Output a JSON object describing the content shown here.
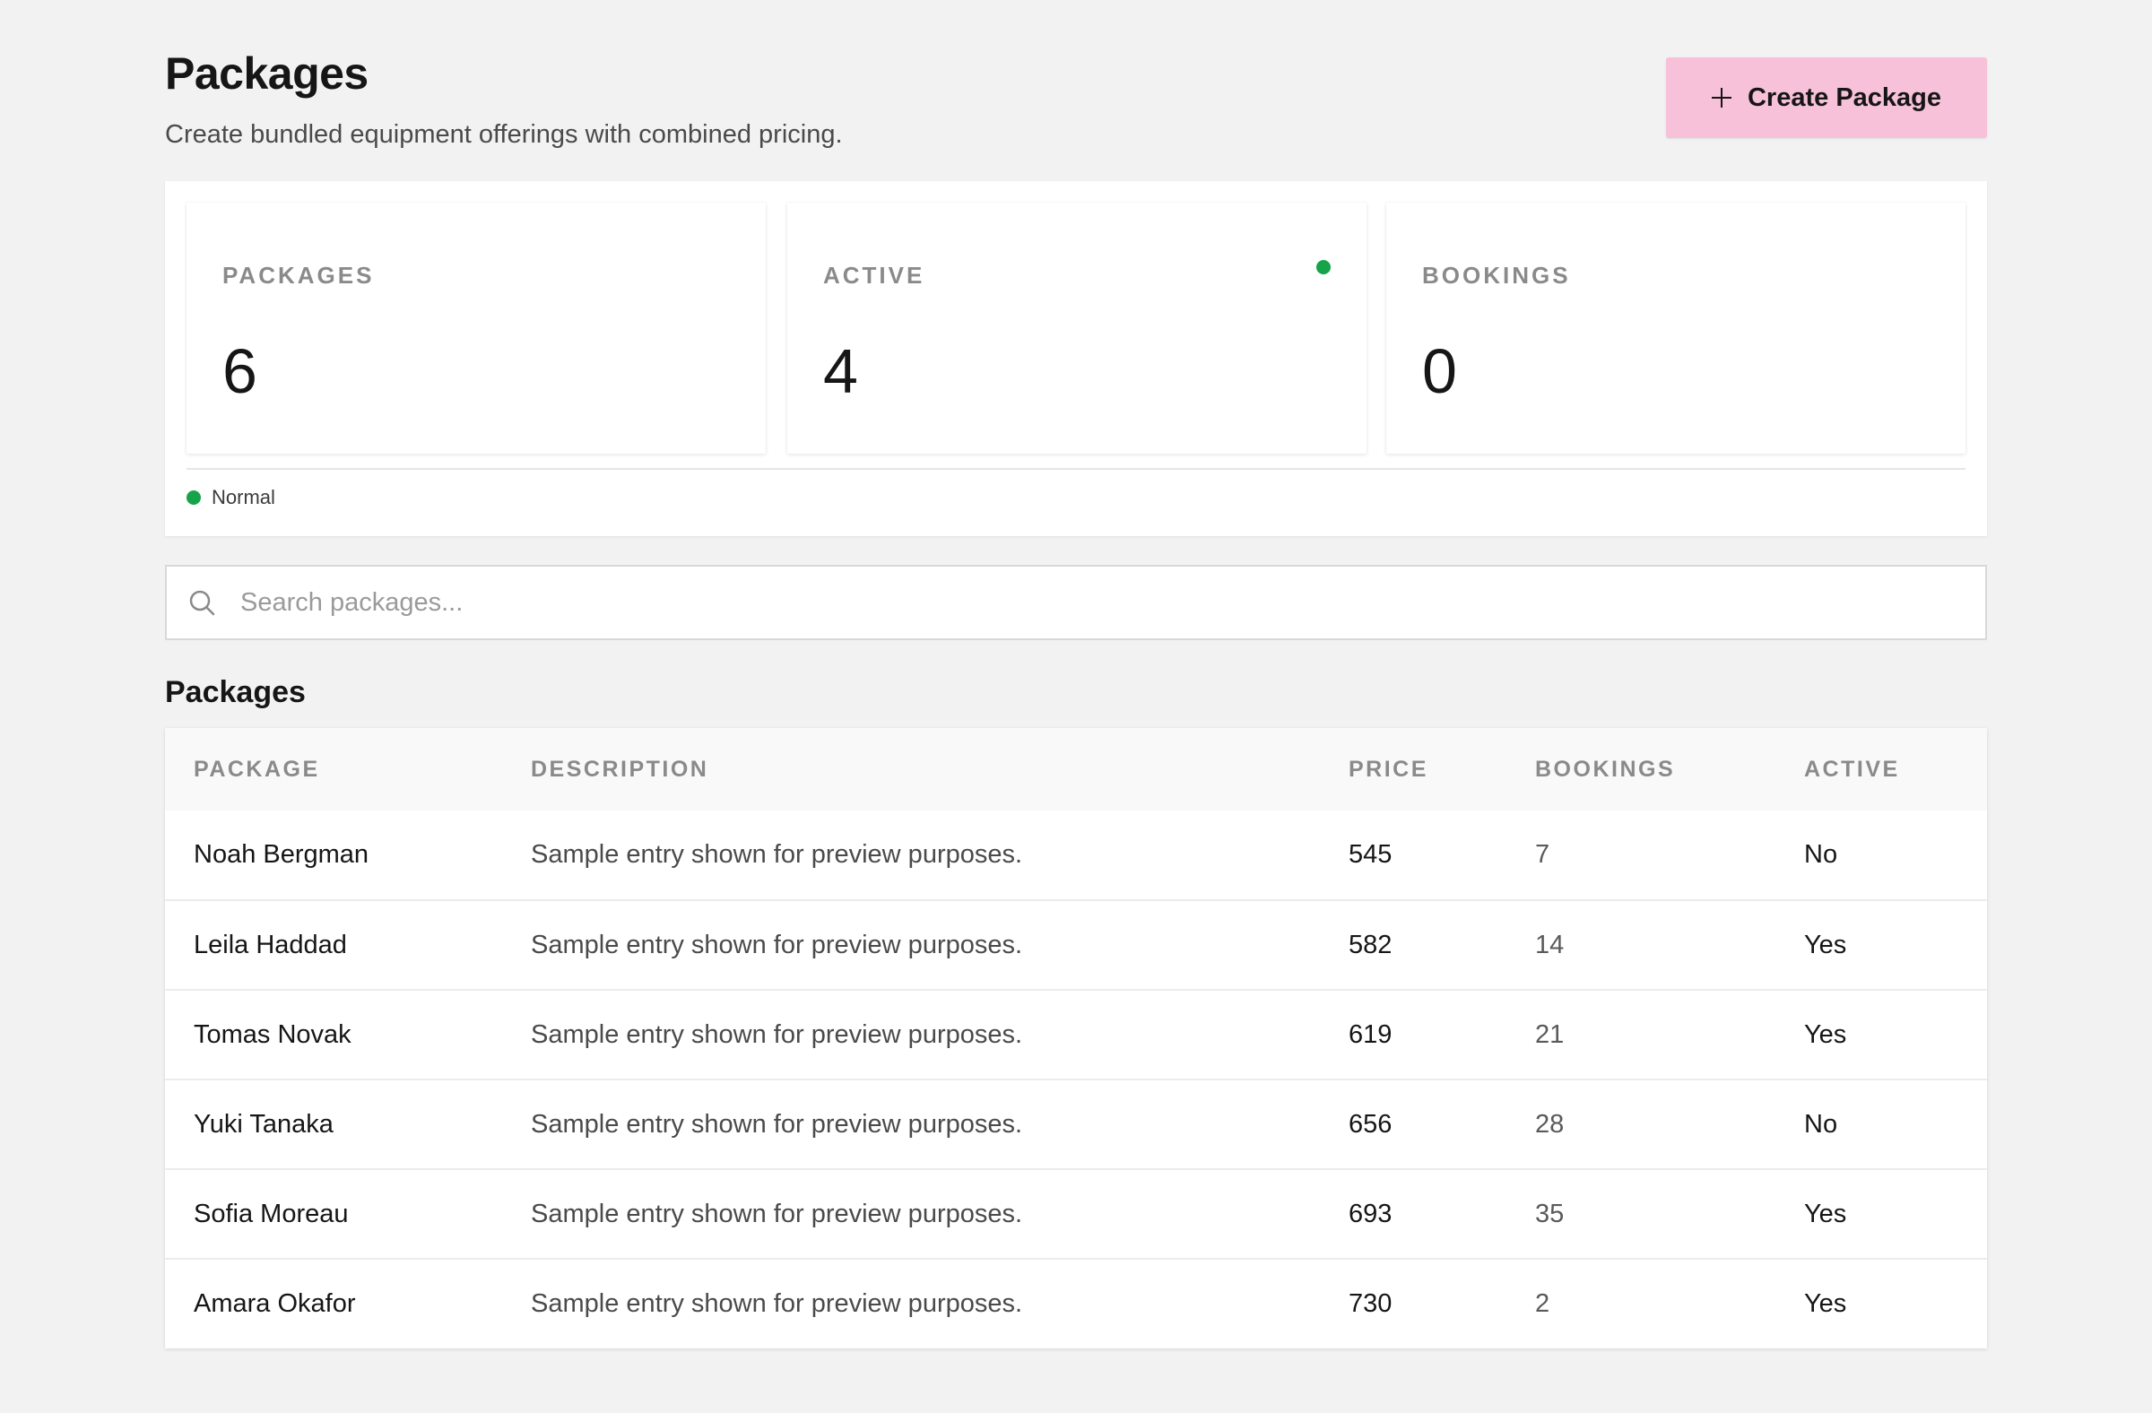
{
  "header": {
    "title": "Packages",
    "subtitle": "Create bundled equipment offerings with combined pricing.",
    "create_button_label": "Create Package",
    "create_button_icon": "plus-icon",
    "create_button_color": "#f7c1d9"
  },
  "stats": {
    "cards": [
      {
        "label": "PACKAGES",
        "value": "6"
      },
      {
        "label": "ACTIVE",
        "value": "4",
        "indicator_color": "#16a34a"
      },
      {
        "label": "BOOKINGS",
        "value": "0"
      }
    ],
    "status": {
      "text": "Normal",
      "color": "#16a34a"
    }
  },
  "search": {
    "placeholder": "Search packages...",
    "value": "",
    "icon": "search-icon"
  },
  "table": {
    "section_title": "Packages",
    "columns": [
      "PACKAGE",
      "DESCRIPTION",
      "PRICE",
      "BOOKINGS",
      "ACTIVE"
    ],
    "rows": [
      {
        "package": "Noah Bergman",
        "description": "Sample entry shown for preview purposes.",
        "price": "545",
        "bookings": "7",
        "active": "No"
      },
      {
        "package": "Leila Haddad",
        "description": "Sample entry shown for preview purposes.",
        "price": "582",
        "bookings": "14",
        "active": "Yes"
      },
      {
        "package": "Tomas Novak",
        "description": "Sample entry shown for preview purposes.",
        "price": "619",
        "bookings": "21",
        "active": "Yes"
      },
      {
        "package": "Yuki Tanaka",
        "description": "Sample entry shown for preview purposes.",
        "price": "656",
        "bookings": "28",
        "active": "No"
      },
      {
        "package": "Sofia Moreau",
        "description": "Sample entry shown for preview purposes.",
        "price": "693",
        "bookings": "35",
        "active": "Yes"
      },
      {
        "package": "Amara Okafor",
        "description": "Sample entry shown for preview purposes.",
        "price": "730",
        "bookings": "2",
        "active": "Yes"
      }
    ]
  }
}
